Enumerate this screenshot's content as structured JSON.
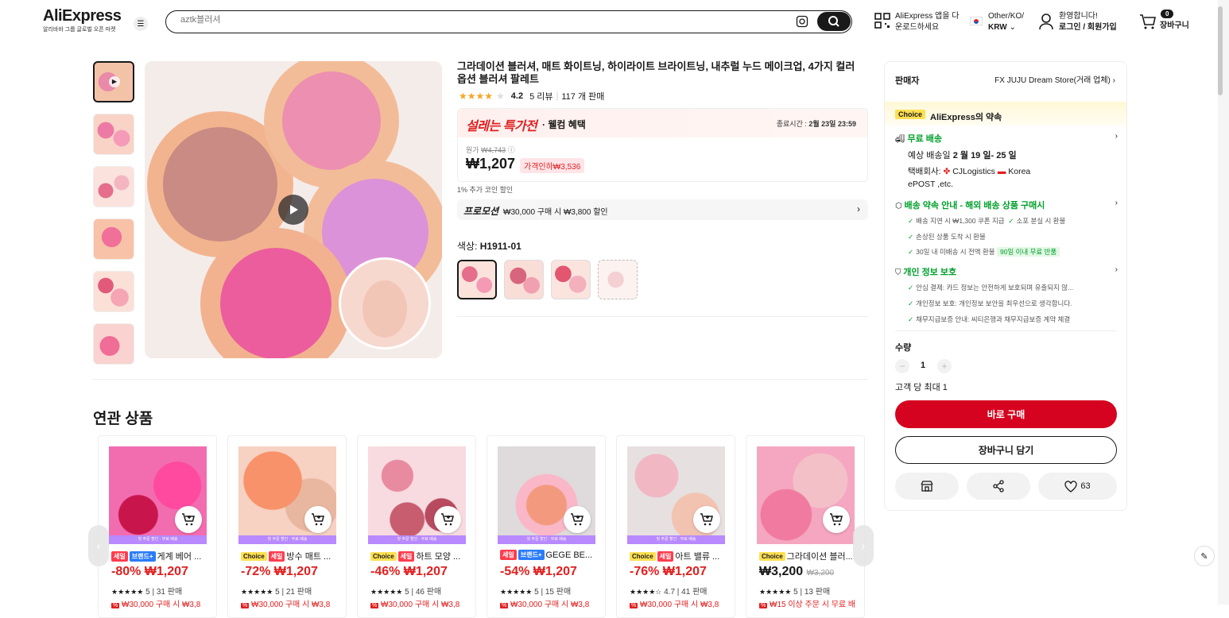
{
  "header": {
    "logo_text": "AliExpress",
    "logo_sub": "알리바바 그룹 글로벌 오픈 마켓",
    "search_placeholder": "aztk블러셔",
    "app_line1": "AliExpress 앱을 다",
    "app_line2": "운로드하세요",
    "region_line1": "Other/KO/",
    "region_line2": "KRW",
    "welcome_line1": "환영합니다!",
    "welcome_line2": "로그인 / 회원가입",
    "cart_count": "0",
    "cart_label": "장바구니"
  },
  "product": {
    "title": "그라데이션 블러셔, 매트 화이트닝, 하이라이트 브라이트닝, 내추럴 누드 메이크업, 4가지 컬러 옵션 블러셔 팔레트",
    "rating": "4.2",
    "reviews": "5 리뷰",
    "sold": "117 개 판매",
    "sale_banner": "설레는 특가전",
    "welcome_benefit": "· 웰컴 혜택",
    "end_label": "종료시간 :",
    "end_time": "2월 23일 23:59",
    "original_label": "원가",
    "original_price": "₩4,743",
    "price": "₩1,207",
    "discount": "가격인하₩3,536",
    "coin_note": "1% 추가 코인 할인",
    "promo_label": "프로모션",
    "promo_text": "₩30,000 구매 시 ₩3,800 할인",
    "color_label": "색상:",
    "color_value": "H1911-01"
  },
  "related": {
    "title": "연관 상품",
    "items": [
      {
        "name": "게계 베어 ...",
        "badges": [
          "세일",
          "브랜드+"
        ],
        "price": "-80% ₩1,207",
        "rating": "5",
        "sold": "31 판매",
        "coupon": "₩30,000 구매 시 ₩3,8"
      },
      {
        "name": "방수 매트 ...",
        "badges": [
          "Choice",
          "세일"
        ],
        "price": "-72% ₩1,207",
        "rating": "5",
        "sold": "21 판매",
        "coupon": "₩30,000 구매 시 ₩3,8"
      },
      {
        "name": "하트 모양 ...",
        "badges": [
          "Choice",
          "세일"
        ],
        "price": "-46% ₩1,207",
        "rating": "5",
        "sold": "46 판매",
        "coupon": "₩30,000 구매 시 ₩3,8"
      },
      {
        "name": "GEGE BE...",
        "badges": [
          "세일",
          "브랜드+"
        ],
        "price": "-54% ₩1,207",
        "rating": "5",
        "sold": "15 판매",
        "coupon": "₩30,000 구매 시 ₩3,8"
      },
      {
        "name": "아트 밸류 ...",
        "badges": [
          "Choice",
          "세일"
        ],
        "price": "-76% ₩1,207",
        "rating": "4.7",
        "sold": "41 판매",
        "coupon": "₩30,000 구매 시 ₩3,8"
      },
      {
        "name": "그라데이션 블러...",
        "badges": [
          "Choice"
        ],
        "price": "₩3,200",
        "old_price": "₩3,200",
        "rating": "5",
        "sold": "13 판매",
        "coupon": "₩15 이상 주문 시 무료 배"
      }
    ],
    "ribbon": "첫 주문 할인 · 무료 배송"
  },
  "sidebar": {
    "seller_label": "판매자",
    "seller_name": "FX JUJU Dream Store(거래 업체)",
    "choice_badge": "Choice",
    "choice_title": "AliExpress의 약속",
    "free_ship": "무료 배송",
    "delivery_label": "예상 배송일",
    "delivery_date": "2 월 19 일- 25 일",
    "carrier_label": "택배회사:",
    "carrier1": "CJLogistics",
    "carrier2": "Korea",
    "carrier3": "ePOST ,etc.",
    "guarantee": "배송 약속 안내 - 해외 배송 상품 구매시",
    "g1": "배송 지연 시 ₩1,300 쿠폰 지급",
    "g2": "소포 분실 시 환불",
    "g3": "손상된 상품 도착 시 환불",
    "g4": "30일 내 미배송 시 전액 환불",
    "g5": "90일 이내 무료 반품",
    "privacy": "개인 정보 보호",
    "p1": "안심 결제: 카드 정보는 안전하게 보호되며 유출되지 않...",
    "p2": "개인정보 보호: 개인정보 보안을 최우선으로 생각합니다.",
    "p3": "채무지급보증 안내: 씨티은행과 채무지급보증 계약 체결",
    "qty_label": "수량",
    "qty_value": "1",
    "qty_limit": "고객 당 최대 1",
    "buy_now": "바로 구매",
    "add_cart": "장바구니 담기",
    "wish_count": "63"
  }
}
